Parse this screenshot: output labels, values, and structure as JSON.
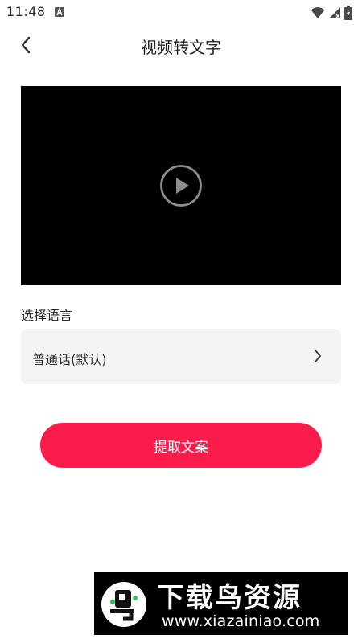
{
  "status_bar": {
    "time": "11:48",
    "icons": [
      "notification-a-icon",
      "wifi-icon",
      "cell-signal-icon",
      "battery-icon"
    ]
  },
  "header": {
    "title": "视频转文字",
    "back_icon": "chevron-left-icon"
  },
  "video": {
    "play_icon": "play-circle-icon"
  },
  "language": {
    "section_label": "选择语言",
    "selected_value": "普通话(默认)",
    "chevron_icon": "chevron-right-icon"
  },
  "actions": {
    "extract_label": "提取文案"
  },
  "watermark": {
    "title": "下载鸟资源",
    "url": "www.xiazainiao.com"
  },
  "colors": {
    "accent": "#fc1c4b",
    "background": "#ffffff",
    "field_background": "#f4f4f4",
    "video_background": "#000000",
    "text_primary": "#222222"
  }
}
